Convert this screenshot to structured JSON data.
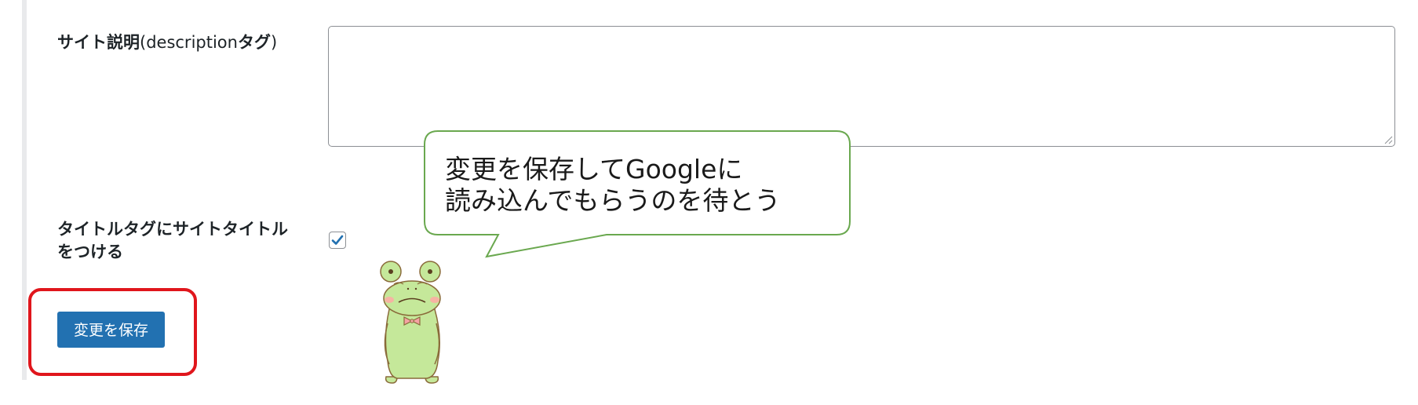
{
  "form": {
    "description_label_jp": "サイト説明",
    "description_label_latin": "(description",
    "description_label_tag": "タグ",
    "description_label_close": ")",
    "description_value": "",
    "title_tag_label_line1": "タイトルタグにサイトタイトル",
    "title_tag_label_line2": "をつける",
    "title_tag_checked": true,
    "save_label": "変更を保存"
  },
  "callout": {
    "line1": "変更を保存してGoogleに",
    "line2": "読み込んでもらうのを待とう"
  },
  "colors": {
    "button": "#2271b1",
    "highlight": "#e0161c",
    "bubble_border": "#6aa84f",
    "frog_body": "#c5e89a"
  }
}
